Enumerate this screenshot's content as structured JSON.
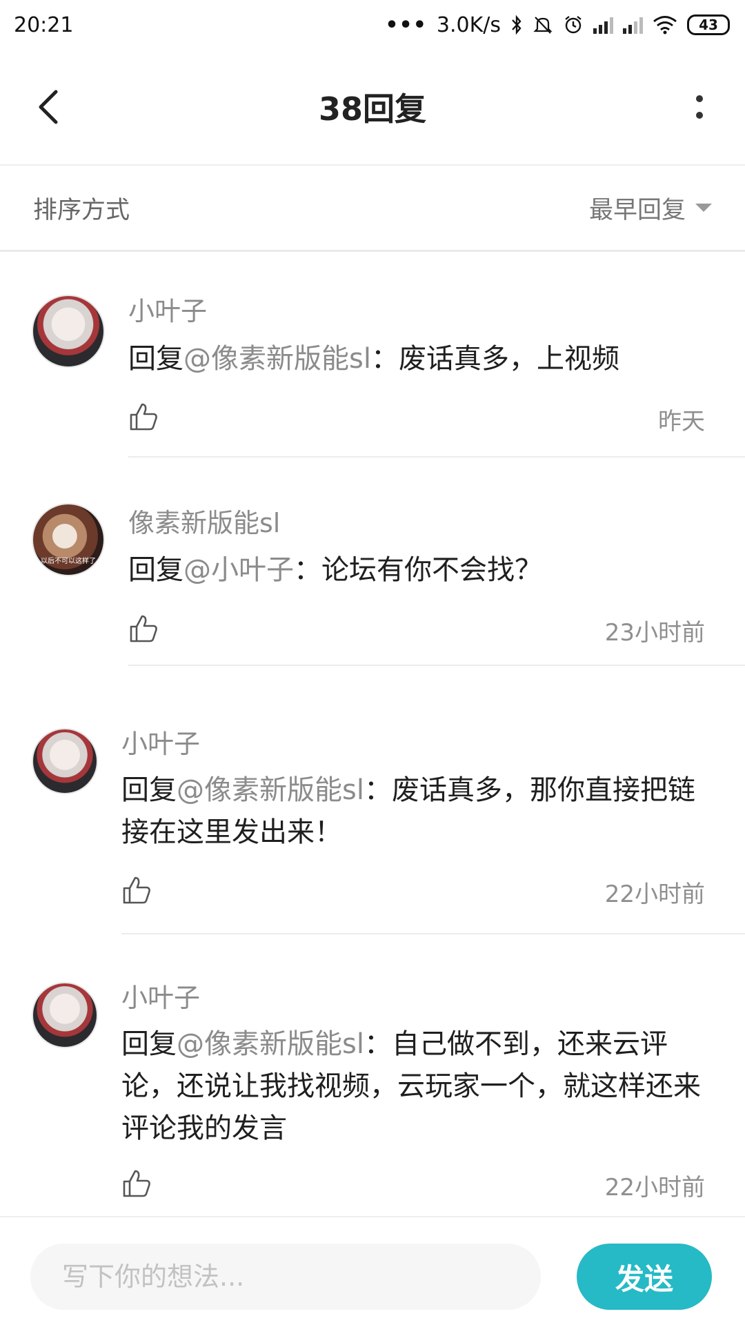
{
  "status_bar": {
    "time": "20:21",
    "network_speed": "3.0K/s",
    "battery": "43",
    "icons": [
      "more-dots-icon",
      "bluetooth-icon",
      "mute-bell-icon",
      "alarm-icon",
      "signal-icon",
      "signal-icon",
      "wifi-icon",
      "battery-icon"
    ]
  },
  "header": {
    "title": "38回复",
    "back_icon": "chevron-left-icon",
    "more_icon": "more-vertical-icon"
  },
  "sort": {
    "label": "排序方式",
    "selected": "最早回复"
  },
  "replies": [
    {
      "username": "小叶子",
      "prefix": "回复",
      "mention": "@像素新版能sl",
      "separator": "：",
      "text": "废话真多，上视频",
      "time": "昨天",
      "avatar": "anime-girl-avatar"
    },
    {
      "username": "像素新版能sl",
      "prefix": "回复",
      "mention": "@小叶子",
      "separator": "：",
      "text": "论坛有你不会找？",
      "time": "23小时前",
      "avatar": "hamster-avatar"
    },
    {
      "username": "小叶子",
      "prefix": "回复",
      "mention": "@像素新版能sl",
      "separator": "：",
      "text": "废话真多，那你直接把链接在这里发出来！",
      "time": "22小时前",
      "avatar": "anime-girl-avatar"
    },
    {
      "username": "小叶子",
      "prefix": "回复",
      "mention": "@像素新版能sl",
      "separator": "：",
      "text": "自己做不到，还来云评论，还说让我找视频，云玩家一个，就这样还来评论我的发言",
      "time": "22小时前",
      "avatar": "anime-girl-avatar"
    }
  ],
  "input": {
    "placeholder": "写下你的想法...",
    "value": ""
  },
  "send_label": "发送",
  "colors": {
    "accent": "#26b9c6",
    "mention": "#8b8b8b"
  }
}
